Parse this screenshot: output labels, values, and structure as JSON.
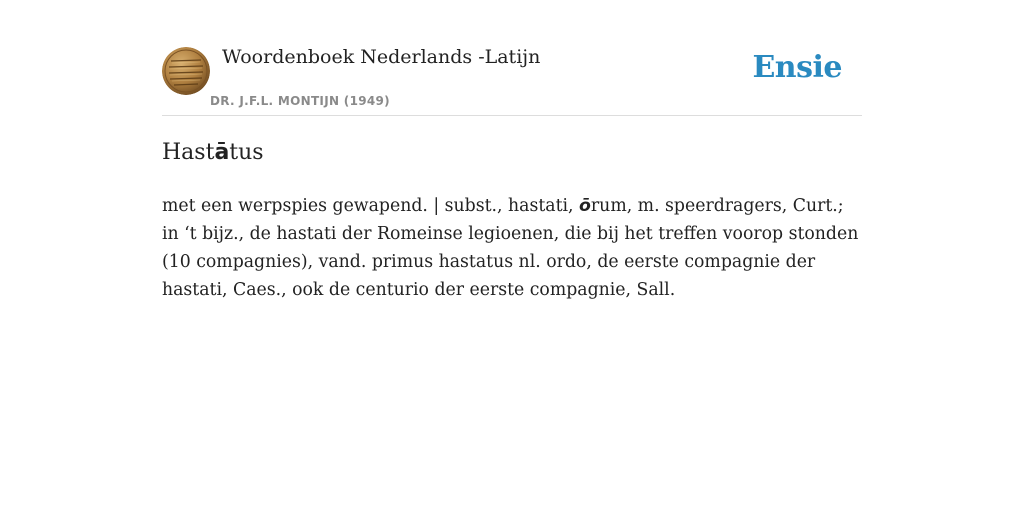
{
  "header": {
    "book_title": "Woordenboek Nederlands -Latijn",
    "book_author": "DR. J.F.L. MONTIJN (1949)",
    "site_name": "Ensie",
    "brand_color": "#2a8ac0",
    "book_icon": "coin-seal-icon"
  },
  "entry": {
    "title_pre": "Hast",
    "title_accent": "ā",
    "title_post": "tus",
    "body_pre": "met een werpspies gewapend. | subst., hastati, ",
    "body_accent": "ō",
    "body_post": "rum, m. speerdragers, Curt.; in ‘t bijz., de hastati der Romeinse legioenen, die bij het treffen voorop stonden (10 compagnies), vand. primus hastatus nl. ordo, de eerste compagnie der hastati, Caes., ook de centurio der eerste compagnie, Sall."
  }
}
